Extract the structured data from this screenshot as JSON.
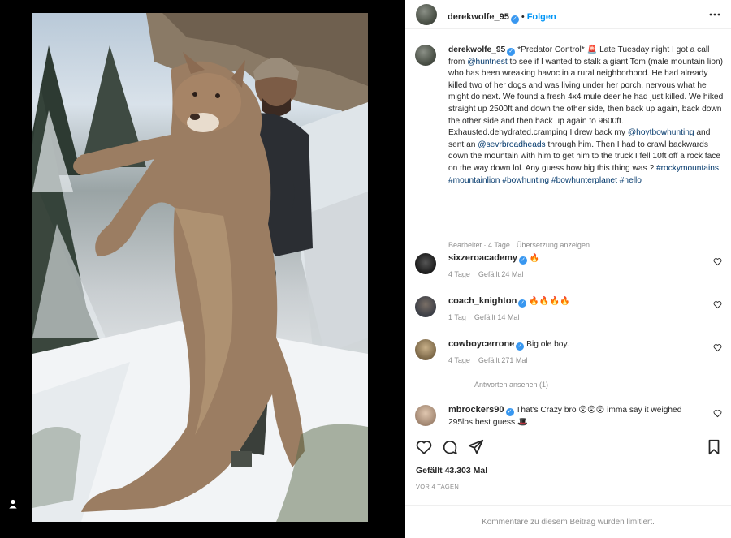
{
  "post": {
    "author": "derekwolfe_95",
    "follow_label": "Folgen",
    "separator": "•",
    "verified_mark": "✓"
  },
  "caption": {
    "author": "derekwolfe_95",
    "seg1": "*Predator Control* 🚨 Late Tuesday night I got a call from ",
    "mention1": "@huntnest",
    "seg2": " to see if I wanted to stalk a giant Tom (male mountain lion) who has been wreaking havoc in a rural neighborhood. He had already killed two of her dogs and was living under her porch, nervous what he might do next. We found a fresh 4x4 mule deer he had just killed. We hiked straight up 2500ft and down the other side, then back up again, back down the other side and then back up again to 9600ft. Exhausted.dehydrated.cramping I drew back my ",
    "mention2": "@hoytbowhunting",
    "seg3": " and sent an ",
    "mention3": "@sevrbroadheads",
    "seg4": " through him. Then I had to crawl backwards down the mountain with him to get him to the truck I fell 10ft off a rock face on the way down lol. Any guess how big this thing was ? ",
    "hashtag1": "#rockymountains",
    "hashtag2": "#mountainlion",
    "hashtag3": "#bowhunting",
    "hashtag4": "#bowhunterplanet",
    "hashtag5": "#hello",
    "edited": "Bearbeitet · 4 Tage",
    "translate": "Übersetzung anzeigen"
  },
  "comments": [
    {
      "user": "sixzeroacademy",
      "text": "🔥",
      "age": "4 Tage",
      "likes": "Gefällt 24 Mal"
    },
    {
      "user": "coach_knighton",
      "text": "🔥🔥🔥🔥",
      "age": "1 Tag",
      "likes": "Gefällt 14 Mal"
    },
    {
      "user": "cowboycerrone",
      "text": "Big ole boy.",
      "age": "4 Tage",
      "likes": "Gefällt 271 Mal"
    },
    {
      "user": "mbrockers90",
      "text": "That's Crazy bro 😲😲😲 imma say it weighed 295lbs best guess 🎩",
      "age": "",
      "likes": ""
    }
  ],
  "view_replies": "Antworten ansehen (1)",
  "likes_total": "Gefällt 43.303 Mal",
  "time_ago": "VOR 4 TAGEN",
  "comments_limited": "Kommentare zu diesem Beitrag wurden limitiert.",
  "icons": {
    "verified": "verified-badge-icon",
    "more": "more-options-icon",
    "like": "heart-icon",
    "comment": "comment-icon",
    "share": "share-icon",
    "save": "bookmark-icon",
    "tag": "user-tag-icon"
  },
  "colors": {
    "accent": "#0095f6",
    "verified": "#3897f0",
    "muted": "#8e8e8e",
    "link": "#00376b"
  }
}
